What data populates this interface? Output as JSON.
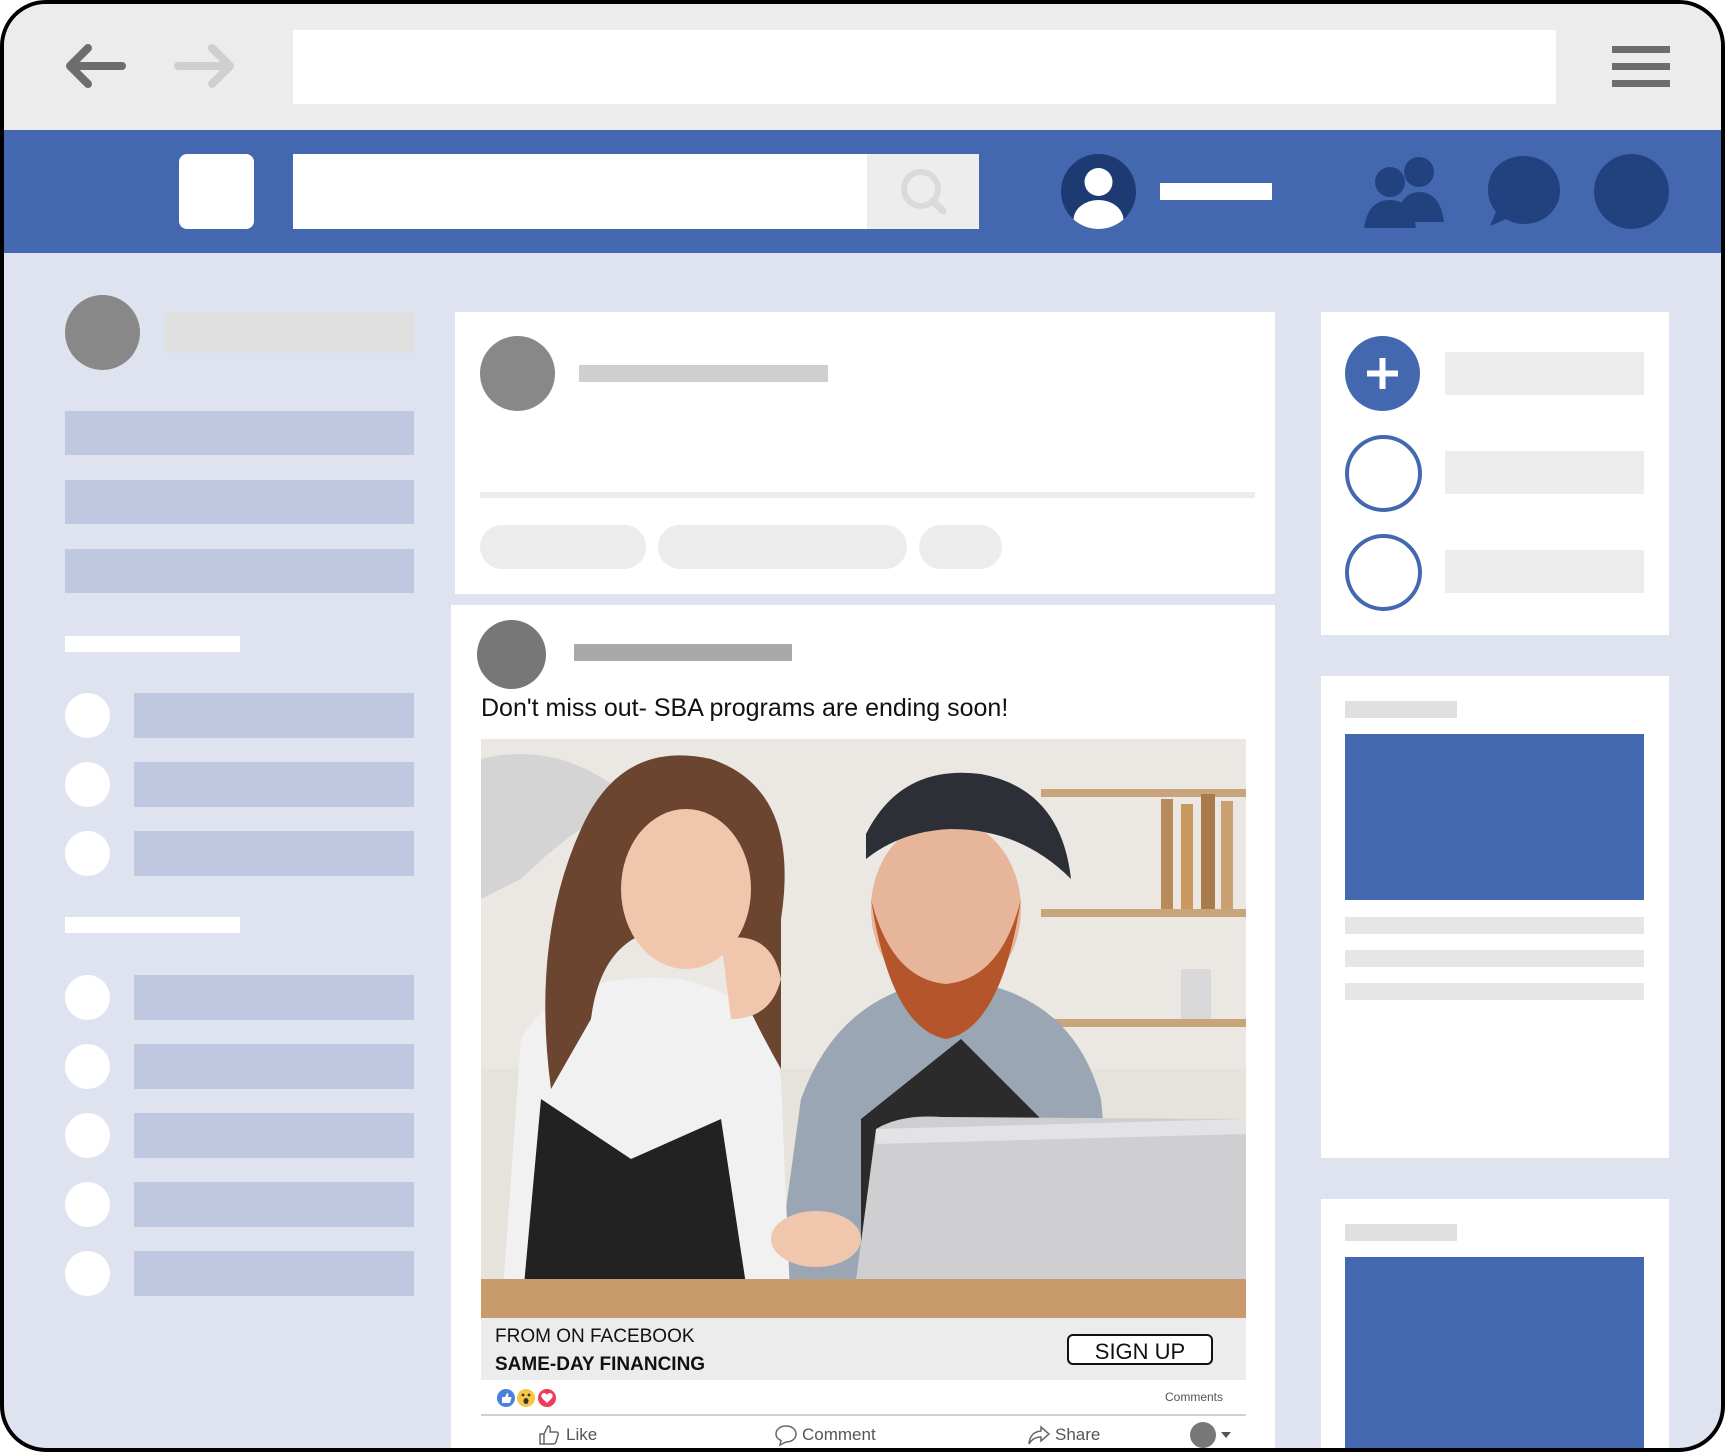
{
  "colors": {
    "brand_blue": "#4368b0",
    "page_bg": "#dfe3ef",
    "sidebar_bar": "#c0c7e0",
    "placeholder_gray": "#e0e0e0"
  },
  "browser": {
    "back_icon": "arrow-left-icon",
    "forward_icon": "arrow-right-icon",
    "menu_icon": "hamburger-menu-icon"
  },
  "header": {
    "search_icon": "search-icon",
    "friends_icon": "friends-icon",
    "messages_icon": "chat-bubble-icon",
    "notifications_icon": "notification-icon"
  },
  "post": {
    "text": "Don't miss out- SBA programs are ending soon!",
    "cta": {
      "from": "FROM ON FACEBOOK",
      "title": "SAME-DAY FINANCING",
      "button": "SIGN UP"
    },
    "reactions": [
      "like",
      "wow",
      "love"
    ],
    "comments_label": "Comments",
    "actions": {
      "like": "Like",
      "comment": "Comment",
      "share": "Share"
    }
  }
}
